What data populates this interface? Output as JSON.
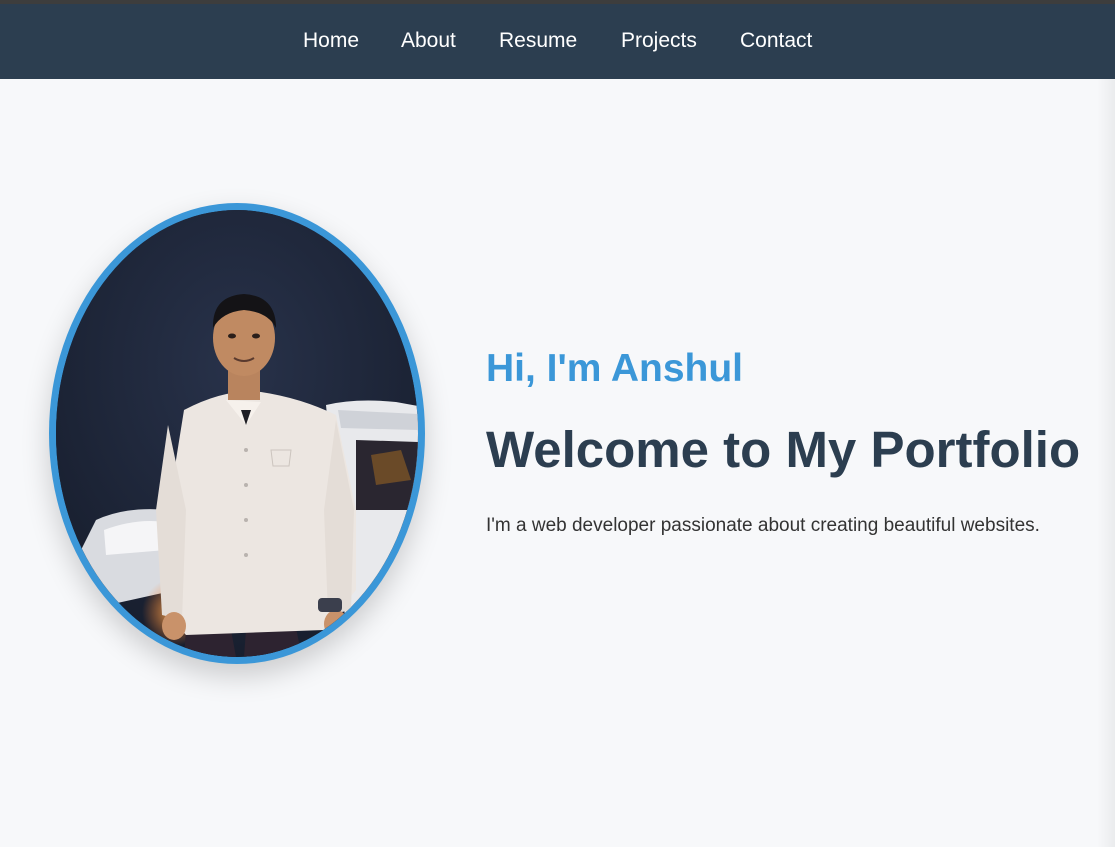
{
  "nav": {
    "items": [
      {
        "label": "Home"
      },
      {
        "label": "About"
      },
      {
        "label": "Resume"
      },
      {
        "label": "Projects"
      },
      {
        "label": "Contact"
      }
    ]
  },
  "hero": {
    "greeting": "Hi, I'm Anshul",
    "title": "Welcome to My Portfolio",
    "tagline": "I'm a web developer passionate about creating beautiful websites."
  },
  "colors": {
    "navbar_bg": "#2c3e50",
    "accent": "#3b97d8",
    "title_text": "#2c3e50",
    "page_bg": "#f7f8fa"
  }
}
